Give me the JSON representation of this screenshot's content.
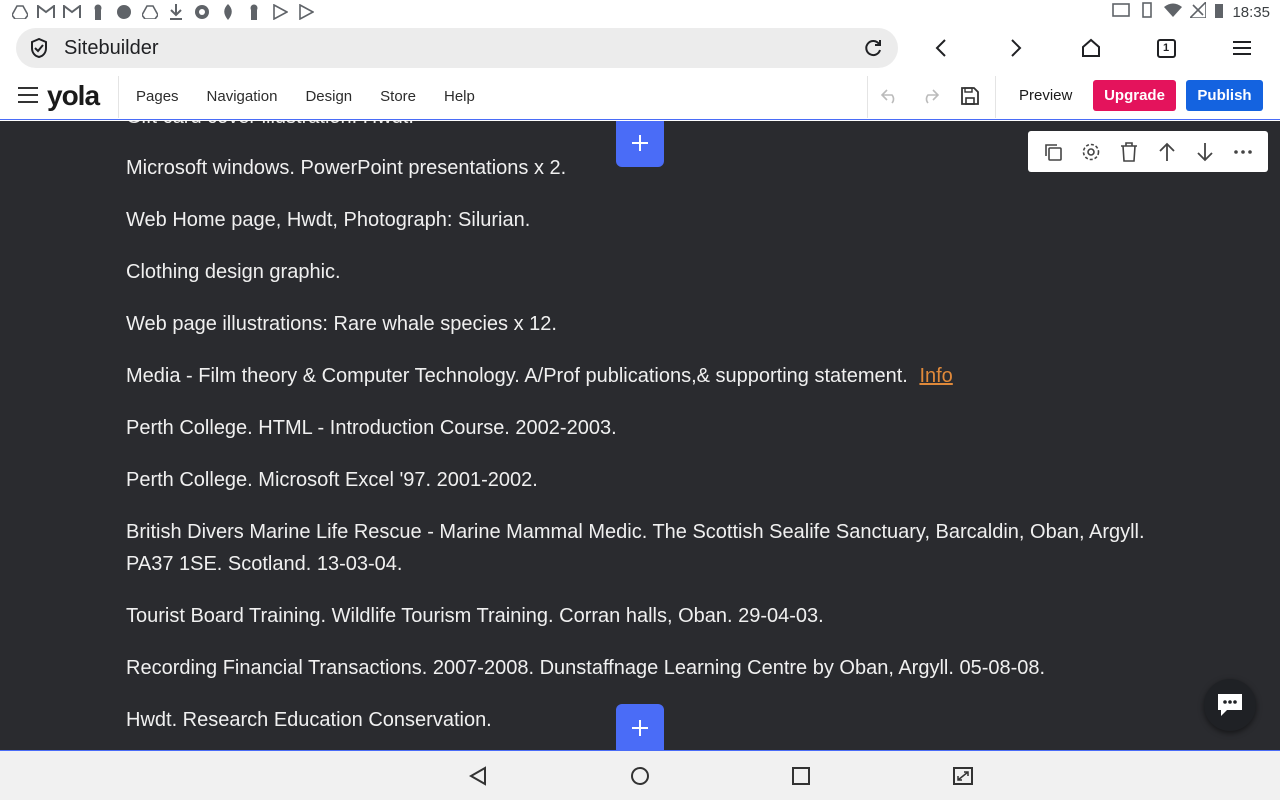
{
  "status_bar": {
    "time": "18:35",
    "left_icons": [
      "drive-icon",
      "gmail-icon",
      "gmail-icon",
      "keyhole-icon",
      "android-icon",
      "drive-icon",
      "download-icon",
      "aperture-icon",
      "leaf-icon",
      "keyhole-icon",
      "play-icon",
      "play-icon"
    ],
    "right_icons": [
      "cast-icon",
      "vibrate-icon",
      "wifi-icon",
      "no-signal-icon",
      "battery-icon"
    ]
  },
  "browser": {
    "url_text": "Sitebuilder",
    "tab_count": "1"
  },
  "toolbar": {
    "logo": "yola",
    "menu": [
      "Pages",
      "Navigation",
      "Design",
      "Store",
      "Help"
    ],
    "preview_label": "Preview",
    "upgrade_label": "Upgrade",
    "publish_label": "Publish",
    "accent_colors": {
      "upgrade": "#e4135c",
      "publish": "#1463e0",
      "add": "#4a6cf7",
      "link": "#e0893a"
    }
  },
  "content": {
    "cut_line": "Gift card cover illustration. Hwdt.",
    "lines": [
      "Microsoft windows. PowerPoint presentations x 2.",
      "Web Home page, Hwdt, Photograph: Silurian.",
      "Clothing design graphic.",
      "Web page illustrations: Rare whale species x 12."
    ],
    "media_line": "Media - Film theory & Computer Technology. A/Prof publications,& supporting statement.",
    "media_link": "Info",
    "lines2": [
      "Perth College. HTML - Introduction Course.  2002-2003.",
      "Perth College. Microsoft Excel '97.  2001-2002."
    ],
    "bdmlr_line1": "British Divers Marine Life Rescue - Marine Mammal Medic. The Scottish Sealife Sanctuary, Barcaldin, Oban, Argyll.",
    "bdmlr_line2": "PA37 1SE. Scotland.  13-03-04.",
    "lines3": [
      "Tourist Board Training. Wildlife Tourism Training. Corran halls, Oban. 29-04-03.",
      "Recording Financial Transactions. 2007-2008. Dunstaffnage Learning Centre by Oban, Argyll. 05-08-08.",
      "Hwdt. Research Education Conservation."
    ]
  }
}
